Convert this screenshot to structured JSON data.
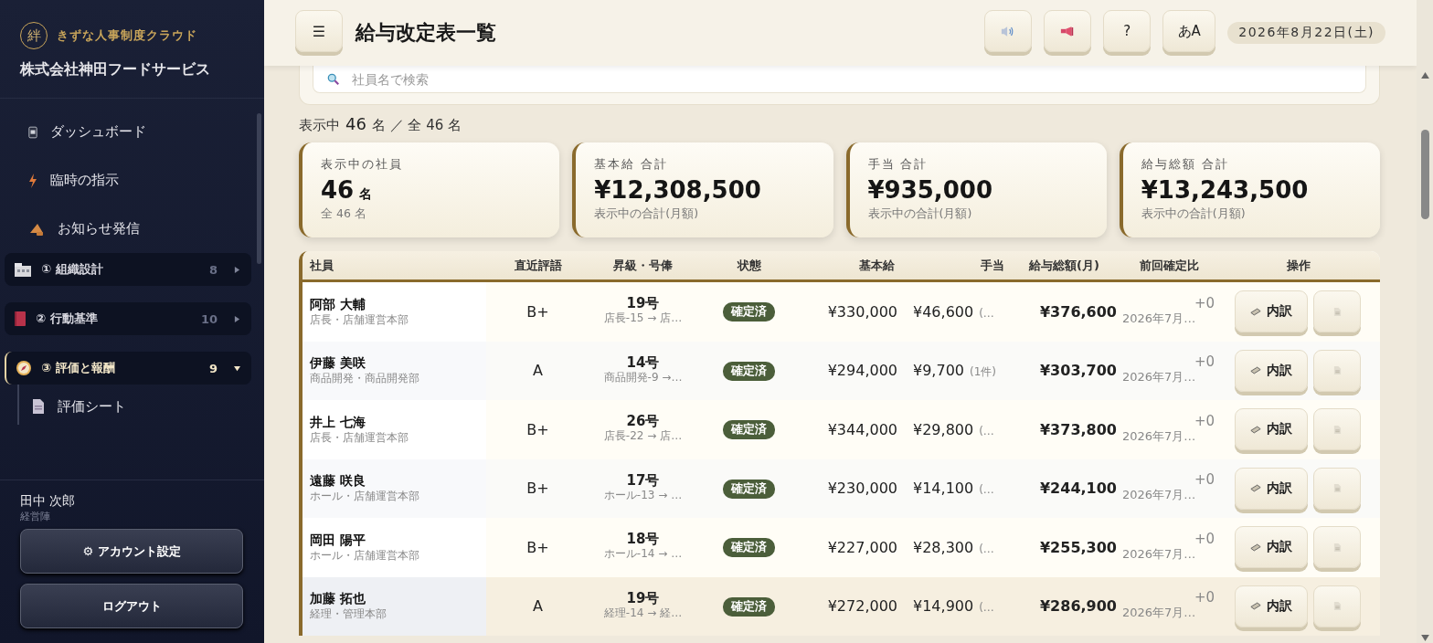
{
  "sidebar": {
    "brand": {
      "mark": "絆",
      "name": "きずな人事制度クラウド"
    },
    "company": "株式会社神田フードサービス",
    "nav": [
      {
        "kind": "dashboard",
        "label": "ダッシュボード"
      },
      {
        "kind": "bolt",
        "label": "臨時の指示"
      },
      {
        "kind": "megaphone",
        "label": "お知らせ発信"
      }
    ],
    "groups": [
      {
        "kind": "org",
        "label": "① 組織設計",
        "count": "8",
        "expanded": false,
        "selected": false
      },
      {
        "kind": "book",
        "label": "② 行動基準",
        "count": "10",
        "expanded": false,
        "selected": false
      },
      {
        "kind": "compass",
        "label": "③ 評価と報酬",
        "count": "9",
        "expanded": true,
        "selected": true,
        "children": [
          {
            "label": "評価シート"
          }
        ]
      }
    ],
    "user": {
      "name": "田中 次郎",
      "role": "経営陣"
    },
    "account_button": "⚙ アカウント設定",
    "logout_button": "ログアウト"
  },
  "header": {
    "menu_button": "☰",
    "title": "給与改定表一覧",
    "help_button": "?",
    "font_button": "あA",
    "date": "2026年8月22日(土)"
  },
  "search": {
    "placeholder": "社員名で検索"
  },
  "count_line": {
    "prefix": "表示中",
    "shown": "46",
    "unit": "名 ／ 全 46 名"
  },
  "cards": [
    {
      "label": "表示中の社員",
      "value": "46",
      "unit": "名",
      "sub": "全 46 名"
    },
    {
      "label": "基本給 合計",
      "value": "¥12,308,500",
      "sub": "表示中の合計(月額)"
    },
    {
      "label": "手当 合計",
      "value": "¥935,000",
      "sub": "表示中の合計(月額)"
    },
    {
      "label": "給与総額 合計",
      "value": "¥13,243,500",
      "sub": "表示中の合計(月額)"
    }
  ],
  "table": {
    "columns": [
      "社員",
      "直近評語",
      "昇級・号俸",
      "状態",
      "基本給",
      "手当",
      "給与総額(月)",
      "前回確定比",
      "操作"
    ],
    "rows": [
      {
        "name": "阿部 大輔",
        "dept": "店長・店舗運営本部",
        "rating": "B+",
        "grade": "19号",
        "grade_change": "店長-15 → 店…",
        "status": "確定済",
        "base": "¥330,000",
        "allowance": "¥46,600",
        "allowance_note": "(…",
        "total": "¥376,600",
        "diff": "+0",
        "diff_date": "2026年7月…",
        "detail_button": "内訳",
        "selected": false
      },
      {
        "name": "伊藤 美咲",
        "dept": "商品開発・商品開発部",
        "rating": "A",
        "grade": "14号",
        "grade_change": "商品開発-9 →…",
        "status": "確定済",
        "base": "¥294,000",
        "allowance": "¥9,700",
        "allowance_note": "(1件)",
        "total": "¥303,700",
        "diff": "+0",
        "diff_date": "2026年7月…",
        "detail_button": "内訳",
        "selected": false
      },
      {
        "name": "井上 七海",
        "dept": "店長・店舗運営本部",
        "rating": "B+",
        "grade": "26号",
        "grade_change": "店長-22 → 店…",
        "status": "確定済",
        "base": "¥344,000",
        "allowance": "¥29,800",
        "allowance_note": "(…",
        "total": "¥373,800",
        "diff": "+0",
        "diff_date": "2026年7月…",
        "detail_button": "内訳",
        "selected": false
      },
      {
        "name": "遠藤 咲良",
        "dept": "ホール・店舗運営本部",
        "rating": "B+",
        "grade": "17号",
        "grade_change": "ホール-13 → …",
        "status": "確定済",
        "base": "¥230,000",
        "allowance": "¥14,100",
        "allowance_note": "(…",
        "total": "¥244,100",
        "diff": "+0",
        "diff_date": "2026年7月…",
        "detail_button": "内訳",
        "selected": false
      },
      {
        "name": "岡田 陽平",
        "dept": "ホール・店舗運営本部",
        "rating": "B+",
        "grade": "18号",
        "grade_change": "ホール-14 → …",
        "status": "確定済",
        "base": "¥227,000",
        "allowance": "¥28,300",
        "allowance_note": "(…",
        "total": "¥255,300",
        "diff": "+0",
        "diff_date": "2026年7月…",
        "detail_button": "内訳",
        "selected": false
      },
      {
        "name": "加藤 拓也",
        "dept": "経理・管理本部",
        "rating": "A",
        "grade": "19号",
        "grade_change": "経理-14 → 経…",
        "status": "確定済",
        "base": "¥272,000",
        "allowance": "¥14,900",
        "allowance_note": "(…",
        "total": "¥286,900",
        "diff": "+0",
        "diff_date": "2026年7月…",
        "detail_button": "内訳",
        "selected": true
      }
    ]
  }
}
